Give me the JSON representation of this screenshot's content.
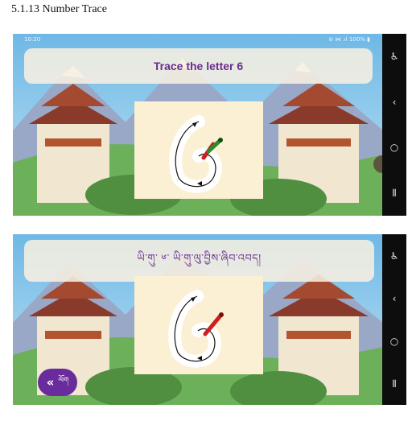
{
  "caption": "5.1.13 Number Trace",
  "screen1": {
    "status_time": "10:20",
    "status_icons": "◆ ✿ ☁ •",
    "status_right": "⊘ ⋈ .ıl 100% ▮",
    "banner_text": "Trace the letter 6",
    "nav": {
      "accessibility": "♿",
      "back": "‹",
      "home": "○",
      "recents": "⦀"
    }
  },
  "screen2": {
    "banner_text": "ཡི་གུ་ ༦་ ཡི་གུ་ལུ་བྱིས་ཞིབ་འབད།",
    "back_button_icon": "«",
    "back_button_label": "ལོག",
    "nav": {
      "accessibility": "♿",
      "back": "‹",
      "home": "○",
      "recents": "⦀"
    }
  },
  "colors": {
    "banner_text": "#6a2c8c",
    "back_button": "#6a2c9c",
    "trace_start": "#2a8c2a",
    "trace_progress": "#cc1f1f"
  }
}
